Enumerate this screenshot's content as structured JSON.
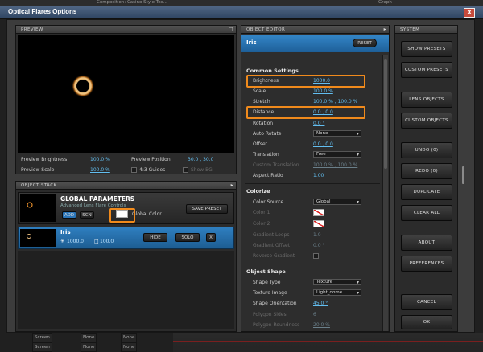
{
  "app": {
    "top_bar": {
      "left_text": "Composition: Casino Style Tex...",
      "right_text": "Graph"
    },
    "title": "Optical Flares Options",
    "close": "X"
  },
  "preview": {
    "header": "PREVIEW",
    "brightness_label": "Preview Brightness",
    "brightness_value": "100.0 %",
    "position_label": "Preview Position",
    "position_value": "30.0 , 30.0",
    "scale_label": "Preview Scale",
    "scale_value": "100.0 %",
    "guides_label": "4:3 Guides",
    "showbg_label": "Show BG"
  },
  "object_stack": {
    "header": "OBJECT STACK",
    "global": {
      "title": "GLOBAL PARAMETERS",
      "subtitle": "Advanced Lens Flare Controls",
      "add": "ADD",
      "scn": "SCN",
      "color_label": "Global Color",
      "save_preset": "SAVE PRESET"
    },
    "item": {
      "name": "Iris",
      "brightness": "1000.0",
      "scale": "100.0",
      "hide": "HIDE",
      "solo": "SOLO",
      "x": "X"
    }
  },
  "editor": {
    "header": "OBJECT EDITOR",
    "object_name": "Iris",
    "reset": "RESET",
    "sections": {
      "common": "Common Settings",
      "colorize": "Colorize",
      "shape": "Object Shape"
    },
    "common": [
      {
        "label": "Brightness",
        "value": "1000.0"
      },
      {
        "label": "Scale",
        "value": "100.0 %"
      },
      {
        "label": "Stretch",
        "value": "100.0 % , 100.0 %"
      },
      {
        "label": "Distance",
        "value": "0.0 , 0.0"
      },
      {
        "label": "Rotation",
        "value": "0.0 °"
      },
      {
        "label": "Auto Rotate",
        "value": "None"
      },
      {
        "label": "Offset",
        "value": "0.0 , 0.0"
      },
      {
        "label": "Translation",
        "value": "Free"
      },
      {
        "label": "Custom Translation",
        "value": "100.0 % , 100.0 %"
      },
      {
        "label": "Aspect Ratio",
        "value": "1.00"
      }
    ],
    "colorize": [
      {
        "label": "Color Source",
        "value": "Global"
      },
      {
        "label": "Color 1",
        "value": ""
      },
      {
        "label": "Color 2",
        "value": ""
      },
      {
        "label": "Gradient Loops",
        "value": "1.0"
      },
      {
        "label": "Gradient Offset",
        "value": "0.0 °"
      },
      {
        "label": "Reverse Gradient",
        "value": ""
      }
    ],
    "shape": [
      {
        "label": "Shape Type",
        "value": "Texture"
      },
      {
        "label": "Texture Image",
        "value": "Light_dome"
      },
      {
        "label": "Shape Orientation",
        "value": "45.0 °"
      },
      {
        "label": "Polygon Sides",
        "value": "6"
      },
      {
        "label": "Polygon Roundness",
        "value": "20.0 %"
      }
    ]
  },
  "system": {
    "header": "SYSTEM",
    "buttons": [
      "SHOW PRESETS",
      "CUSTOM PRESETS",
      "LENS OBJECTS",
      "CUSTOM OBJECTS",
      "UNDO (0)",
      "REDO (0)",
      "DUPLICATE",
      "CLEAR ALL",
      "ABOUT",
      "PREFERENCES",
      "CANCEL",
      "OK"
    ]
  },
  "bottom_bar": {
    "items": [
      "Screen",
      "None",
      "None",
      "Screen",
      "None",
      "None"
    ]
  },
  "colors": {
    "accent": "#3a8fd0",
    "highlight": "#f08a1c",
    "link": "#62bef0"
  }
}
